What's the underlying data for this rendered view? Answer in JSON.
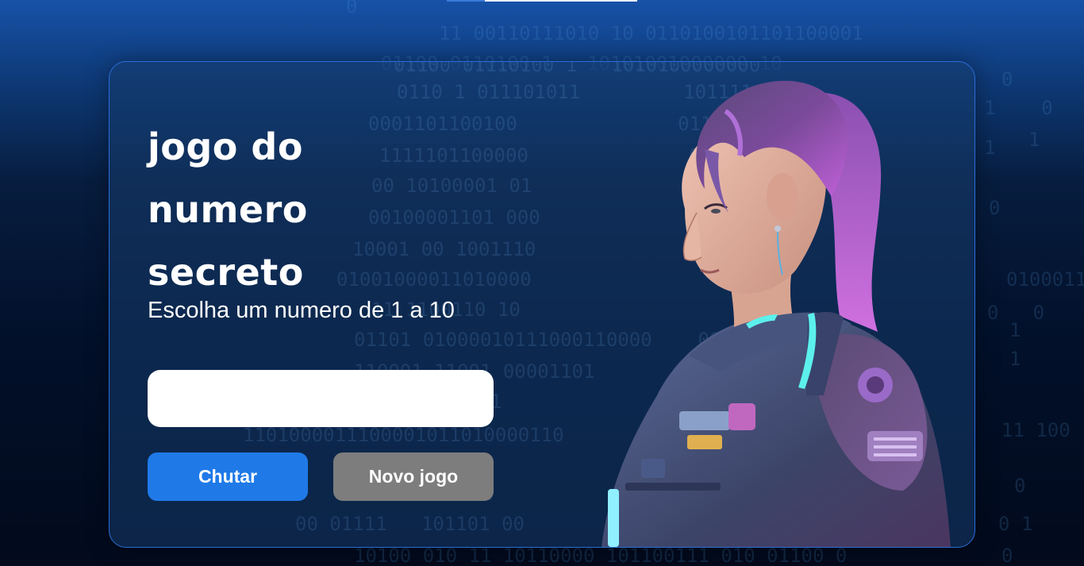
{
  "game": {
    "title": "jogo do numero secreto",
    "instructions": "Escolha um numero de 1 a 10",
    "guess_value": ""
  },
  "buttons": {
    "guess_label": "Chutar",
    "new_game_label": "Novo jogo"
  },
  "decor": {
    "background_text": "binary digits",
    "illustration": "woman-in-sci-fi-armor-illustration"
  },
  "colors": {
    "primary_button": "#1f7ae8",
    "secondary_button": "#7d7d7d",
    "card_border": "#2a6ed8",
    "title_text": "#ffffff"
  }
}
